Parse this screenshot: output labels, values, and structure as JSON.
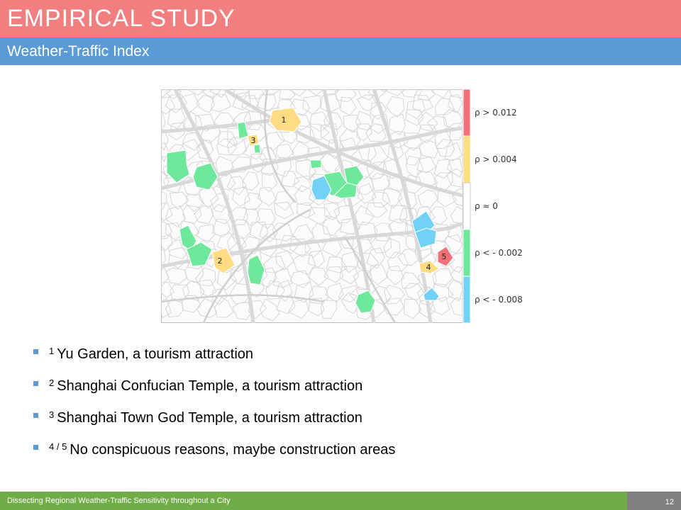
{
  "header": {
    "title": "EMPIRICAL STUDY",
    "subtitle": "Weather-Traffic Index"
  },
  "map": {
    "legend": [
      {
        "label": "ρ > 0.012",
        "color": "#f27178"
      },
      {
        "label": "ρ > 0.004",
        "color": "#ffdc82"
      },
      {
        "label": "ρ ≈ 0",
        "color": "#ffffff"
      },
      {
        "label": "ρ < - 0.002",
        "color": "#6ee89a"
      },
      {
        "label": "ρ < - 0.008",
        "color": "#72d2f5"
      }
    ],
    "markers": [
      "1",
      "2",
      "3",
      "4",
      "5"
    ]
  },
  "bullets": [
    {
      "num": "1",
      "text": "Yu Garden, a tourism attraction"
    },
    {
      "num": "2",
      "text": "Shanghai Confucian Temple, a tourism attraction"
    },
    {
      "num": "3",
      "text": "Shanghai Town God Temple, a tourism attraction"
    },
    {
      "num": "4 / 5",
      "text": "No conspicuous reasons, maybe construction areas"
    }
  ],
  "footer": {
    "text": "Dissecting Regional Weather-Traffic Sensitivity throughout a City",
    "page": "12"
  }
}
